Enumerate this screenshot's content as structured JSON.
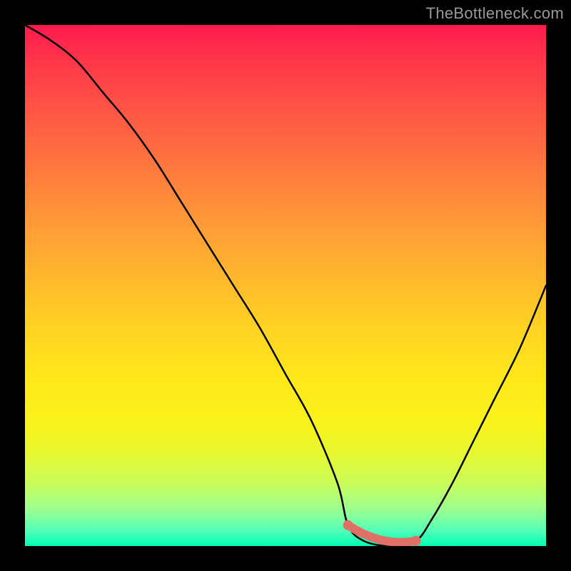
{
  "watermark": "TheBottleneck.com",
  "colors": {
    "page_bg": "#000000",
    "curve": "#000000",
    "segment": "#e07066",
    "watermark": "#999999",
    "gradient_top": "#ff1a4d",
    "gradient_bottom": "#00ffb4"
  },
  "chart_data": {
    "type": "line",
    "title": "",
    "xlabel": "",
    "ylabel": "",
    "xlim": [
      0,
      100
    ],
    "ylim": [
      0,
      100
    ],
    "grid": false,
    "legend": false,
    "annotations": [
      {
        "type": "highlight_segment",
        "x_range": [
          62,
          75
        ],
        "y": 0,
        "color": "#e07066"
      }
    ],
    "series": [
      {
        "name": "bottleneck_curve",
        "x": [
          0,
          5,
          10,
          15,
          20,
          25,
          30,
          35,
          40,
          45,
          50,
          55,
          60,
          62,
          65,
          70,
          75,
          78,
          82,
          86,
          90,
          95,
          100
        ],
        "y": [
          100,
          97,
          93,
          87,
          81,
          74,
          66,
          58,
          50,
          42,
          33,
          24,
          12,
          4,
          1,
          0,
          1,
          5,
          12,
          20,
          28,
          38,
          50
        ]
      }
    ]
  }
}
